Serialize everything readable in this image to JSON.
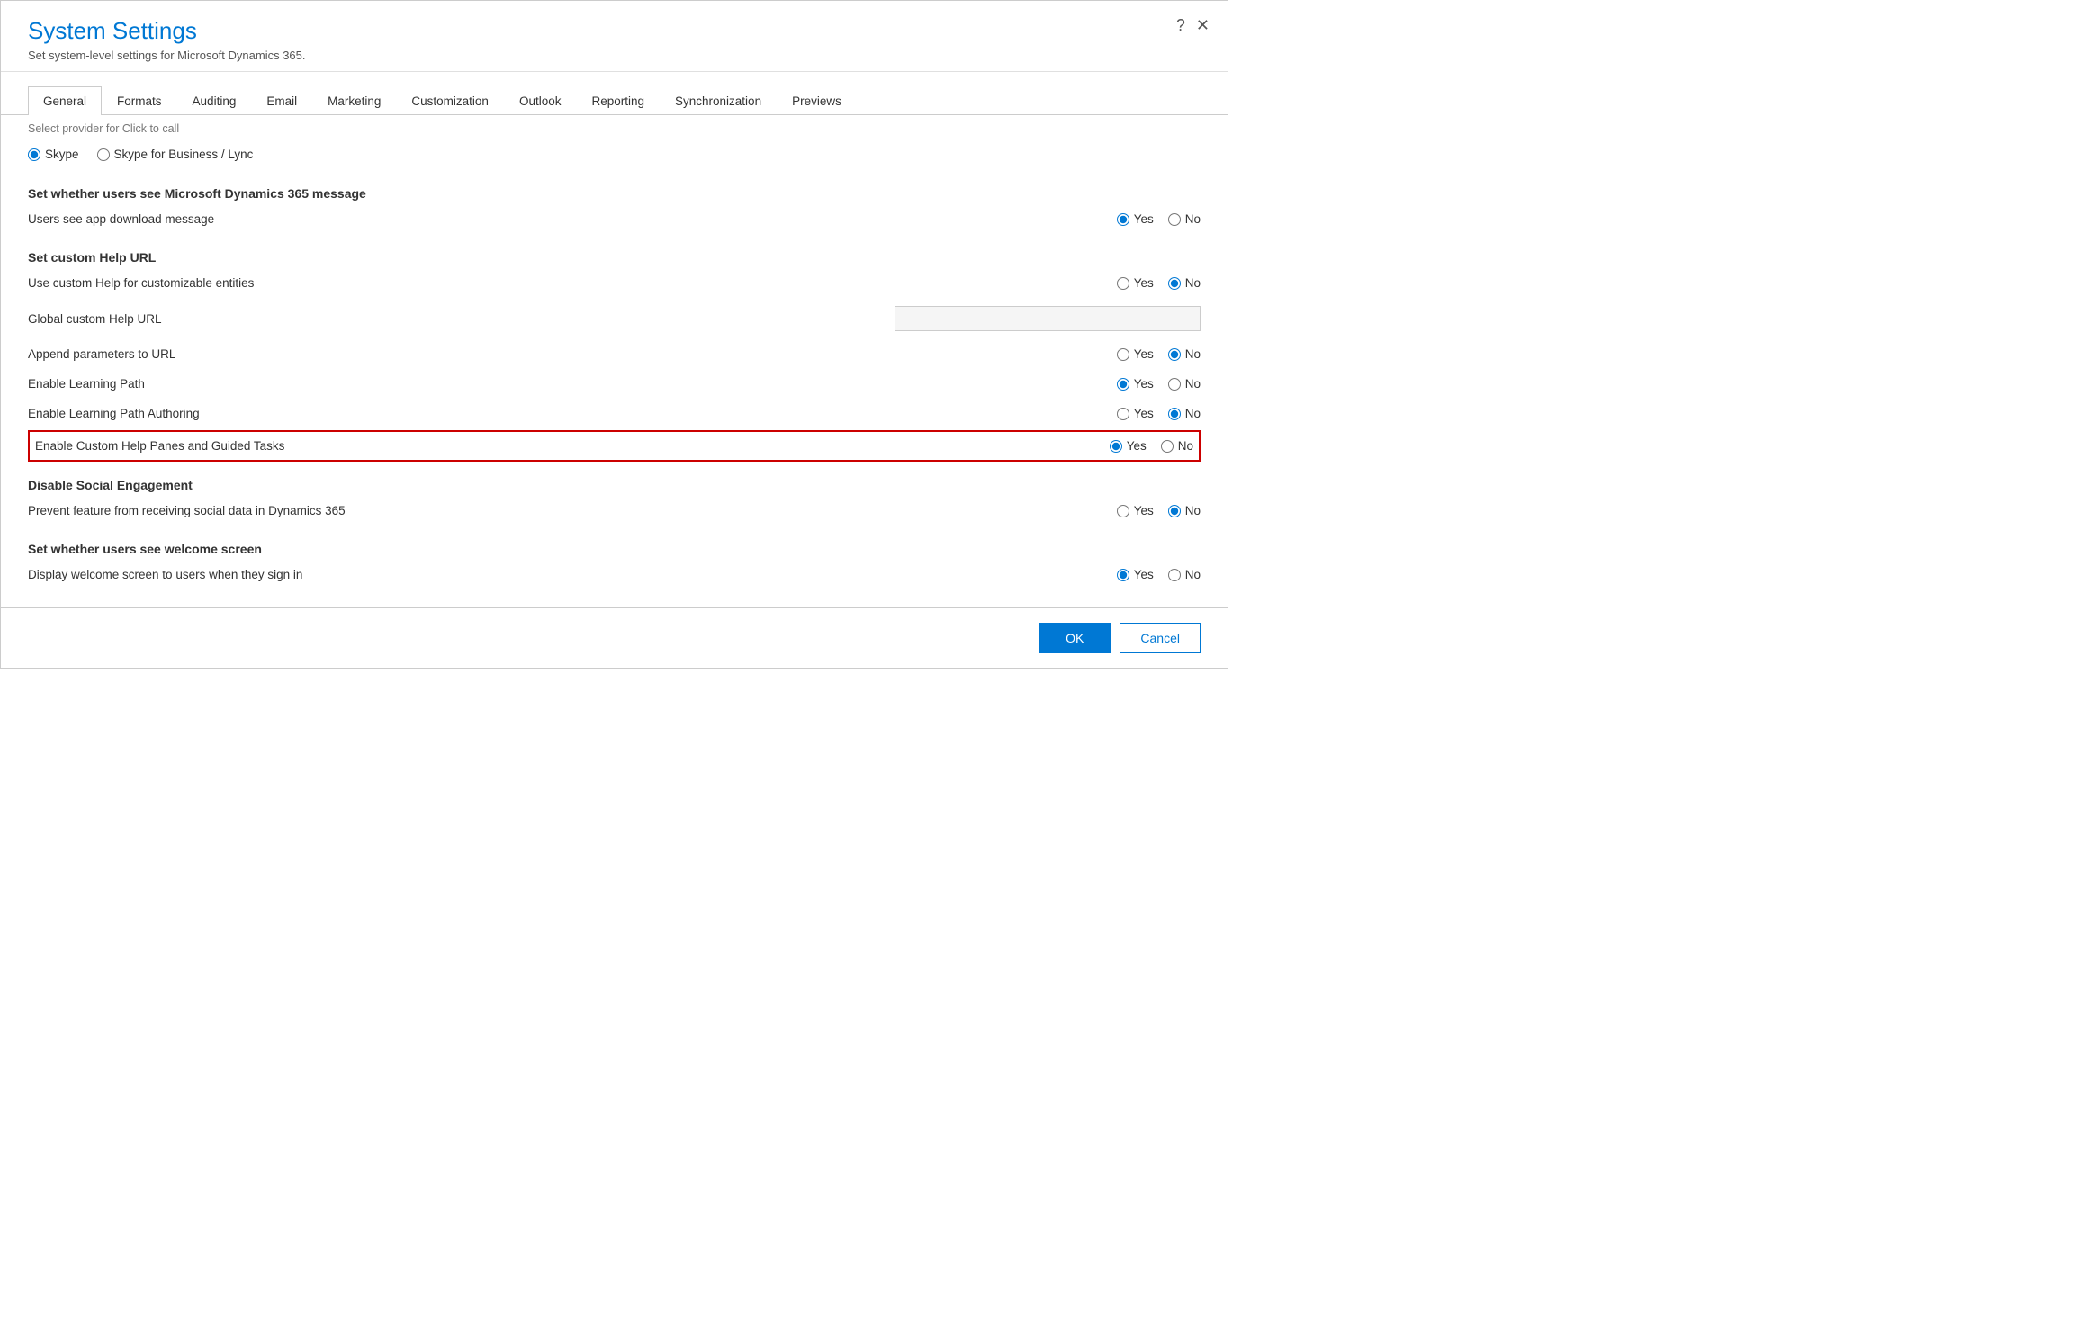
{
  "dialog": {
    "title": "System Settings",
    "subtitle": "Set system-level settings for Microsoft Dynamics 365.",
    "help_icon": "?",
    "close_icon": "✕"
  },
  "tabs": [
    {
      "label": "General",
      "active": true
    },
    {
      "label": "Formats",
      "active": false
    },
    {
      "label": "Auditing",
      "active": false
    },
    {
      "label": "Email",
      "active": false
    },
    {
      "label": "Marketing",
      "active": false
    },
    {
      "label": "Customization",
      "active": false
    },
    {
      "label": "Outlook",
      "active": false
    },
    {
      "label": "Reporting",
      "active": false
    },
    {
      "label": "Synchronization",
      "active": false
    },
    {
      "label": "Previews",
      "active": false
    }
  ],
  "scroll_hint": "Select provider for Click to call",
  "click_to_call": {
    "options": [
      {
        "label": "Skype",
        "selected": true
      },
      {
        "label": "Skype for Business / Lync",
        "selected": false
      }
    ]
  },
  "sections": [
    {
      "id": "dynamics_message",
      "title": "Set whether users see Microsoft Dynamics 365 message",
      "settings": [
        {
          "id": "app_download",
          "label": "Users see app download message",
          "yes": true,
          "no": false,
          "highlighted": false
        }
      ]
    },
    {
      "id": "custom_help_url",
      "title": "Set custom Help URL",
      "settings": [
        {
          "id": "use_custom_help",
          "label": "Use custom Help for customizable entities",
          "yes": false,
          "no": true,
          "highlighted": false,
          "has_input": false
        },
        {
          "id": "global_custom_help_url",
          "label": "Global custom Help URL",
          "yes": null,
          "no": null,
          "highlighted": false,
          "has_input": true,
          "input_value": ""
        },
        {
          "id": "append_params",
          "label": "Append parameters to URL",
          "yes": false,
          "no": true,
          "highlighted": false
        },
        {
          "id": "enable_learning_path",
          "label": "Enable Learning Path",
          "yes": true,
          "no": false,
          "highlighted": false
        },
        {
          "id": "enable_learning_path_authoring",
          "label": "Enable Learning Path Authoring",
          "yes": false,
          "no": true,
          "highlighted": false
        },
        {
          "id": "enable_custom_help_panes",
          "label": "Enable Custom Help Panes and Guided Tasks",
          "yes": true,
          "no": false,
          "highlighted": true
        }
      ]
    },
    {
      "id": "social_engagement",
      "title": "Disable Social Engagement",
      "settings": [
        {
          "id": "prevent_social_data",
          "label": "Prevent feature from receiving social data in Dynamics 365",
          "yes": false,
          "no": true,
          "highlighted": false
        }
      ]
    },
    {
      "id": "welcome_screen",
      "title": "Set whether users see welcome screen",
      "settings": [
        {
          "id": "display_welcome",
          "label": "Display welcome screen to users when they sign in",
          "yes": true,
          "no": false,
          "highlighted": false
        }
      ]
    }
  ],
  "footer": {
    "ok_label": "OK",
    "cancel_label": "Cancel"
  }
}
